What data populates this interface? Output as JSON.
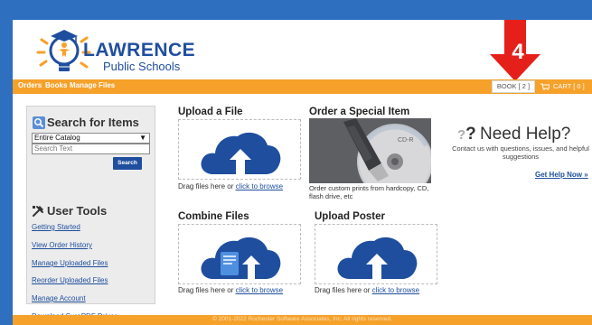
{
  "brand": {
    "name": "LAWRENCE",
    "subtitle": "Public Schools",
    "primary_color": "#1f4e9e",
    "accent_color": "#f5a12a"
  },
  "annotation": {
    "number": "4",
    "color": "#e5201b"
  },
  "nav": {
    "items": [
      "Orders",
      "Books",
      "Manage Files"
    ],
    "book_label": "BOOK [ 2 ]",
    "cart_label": "CART [ 0 ]"
  },
  "sidebar": {
    "search_title": "Search for Items",
    "catalog_select": "Entire Catalog",
    "search_placeholder": "Search Text",
    "search_button": "Search",
    "tools_title": "User Tools",
    "links": [
      "Getting Started",
      "View Order History",
      "Manage Uploaded Files",
      "Reorder Uploaded Files",
      "Manage Account",
      "Download SurePDF Driver"
    ]
  },
  "cards": {
    "upload": {
      "title": "Upload a File",
      "drag_text": "Drag files here or ",
      "link_text": "click to browse"
    },
    "special": {
      "title": "Order a Special Item",
      "description": "Order custom prints from hardcopy, CD, flash drive, etc"
    },
    "combine": {
      "title": "Combine Files",
      "drag_text": "Drag files here or ",
      "link_text": "click to browse"
    },
    "poster": {
      "title": "Upload Poster",
      "drag_text": "Drag files here or ",
      "link_text": "click to browse"
    }
  },
  "help": {
    "title": "Need Help?",
    "text": "Contact us with questions, issues, and helpful suggestions",
    "link": "Get Help Now »"
  },
  "footer": {
    "text": "© 2001-2022 Rochester Software Associates, Inc. All rights reserved."
  }
}
